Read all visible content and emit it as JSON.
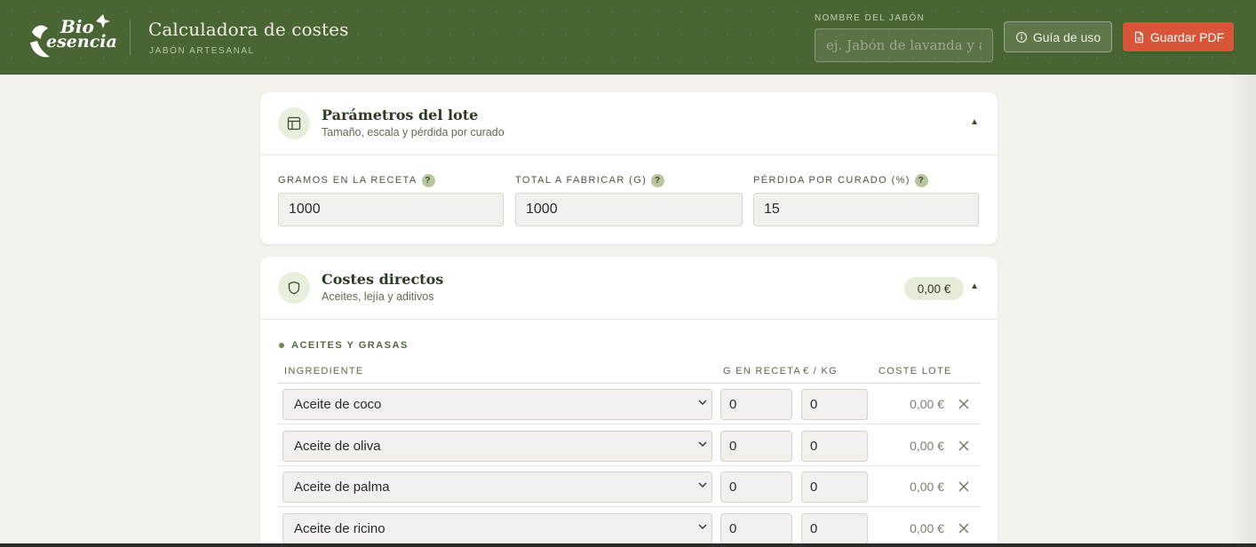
{
  "header": {
    "logo_line1": "Bio",
    "logo_line2": "esencia",
    "title": "Calculadora de costes",
    "subtitle": "JABÓN ARTESANAL",
    "soap_name_label": "NOMBRE DEL JABÓN",
    "soap_name_placeholder": "ej. Jabón de lavanda y arcilla",
    "soap_name_value": "",
    "guide_button": "Guía de uso",
    "pdf_button": "Guardar PDF",
    "icons": {
      "guide": "info-icon",
      "pdf": "document-icon"
    },
    "colors": {
      "bar": "#4a6534",
      "pdf_button": "#d9553a"
    }
  },
  "batch_card": {
    "title": "Parámetros del lote",
    "subtitle": "Tamaño, escala y pérdida por curado",
    "icon": "layout-icon",
    "collapse_glyph": "▲",
    "params": [
      {
        "label": "GRAMOS EN LA RECETA",
        "help": "?",
        "value": "1000"
      },
      {
        "label": "TOTAL A FABRICAR (G)",
        "help": "?",
        "value": "1000"
      },
      {
        "label": "PÉRDIDA POR CURADO (%)",
        "help": "?",
        "value": "15"
      }
    ]
  },
  "direct_costs_card": {
    "title": "Costes directos",
    "subtitle": "Aceites, lejía y aditivos",
    "icon": "shield-icon",
    "total": "0,00 €",
    "collapse_glyph": "▲",
    "section_title": "ACEITES Y GRASAS",
    "columns": {
      "ingredient": "INGREDIENTE",
      "grams": "G EN RECETA",
      "price": "€ / KG",
      "cost": "COSTE LOTE"
    },
    "rows": [
      {
        "ingredient": "Aceite de coco",
        "grams": "0",
        "price": "0",
        "cost": "0,00 €"
      },
      {
        "ingredient": "Aceite de oliva",
        "grams": "0",
        "price": "0",
        "cost": "0,00 €"
      },
      {
        "ingredient": "Aceite de palma",
        "grams": "0",
        "price": "0",
        "cost": "0,00 €"
      },
      {
        "ingredient": "Aceite de ricino",
        "grams": "0",
        "price": "0",
        "cost": "0,00 €"
      }
    ]
  }
}
